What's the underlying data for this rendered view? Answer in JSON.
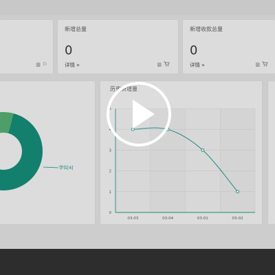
{
  "stats": [
    {
      "title": "",
      "value": "",
      "link": "",
      "icons": "",
      "icon_name": "flag-icon"
    },
    {
      "title": "新增总量",
      "value": "0",
      "link": "详情",
      "icons": "",
      "icon_name": "cart-icon"
    },
    {
      "title": "新增收款总量",
      "value": "0",
      "link": "详情",
      "icons": "",
      "icon_name": "cart-icon"
    }
  ],
  "donut_label": "学位[4]",
  "history_chart": {
    "title": "历史新增量",
    "chart_data": {
      "type": "line",
      "categories": [
        "03-03",
        "03-04",
        "03-01",
        "03-02"
      ],
      "values": [
        4,
        4,
        3,
        1
      ],
      "ylim": [
        0,
        5
      ],
      "yticks": [
        "0",
        "1",
        "2",
        "3",
        "4",
        "5"
      ],
      "color": "#1c8c7a",
      "grid": true
    }
  },
  "colors": {
    "teal": "#12806d",
    "blue": "#2e6fbe",
    "green": "#4f9e6a",
    "line": "#1c8c7a"
  }
}
